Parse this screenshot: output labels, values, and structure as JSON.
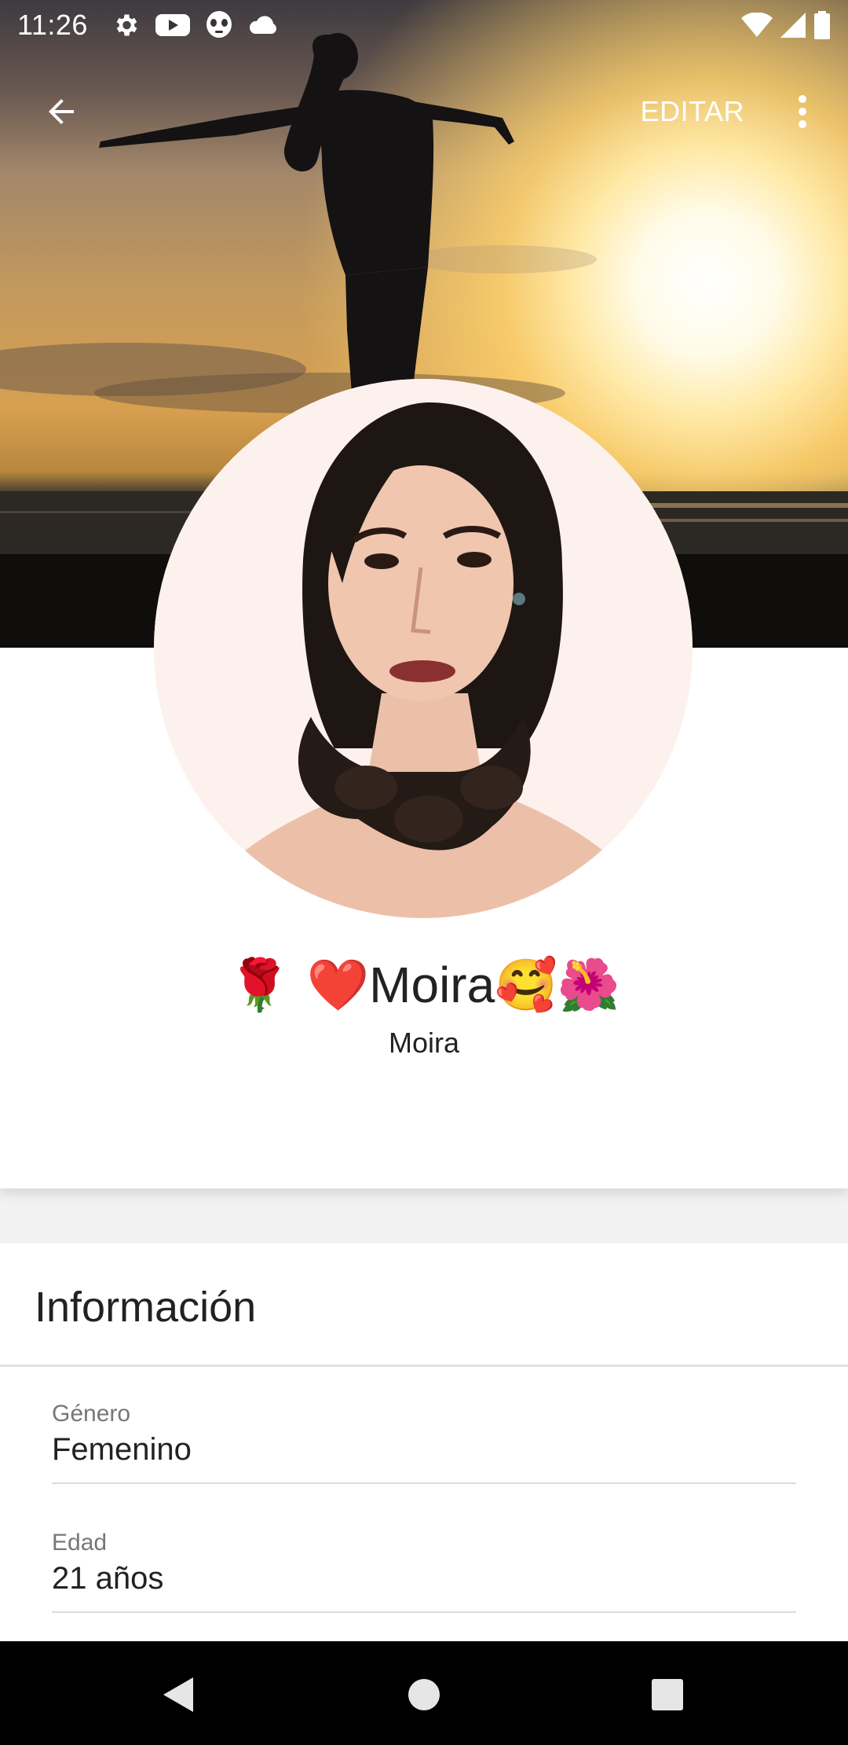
{
  "status_bar": {
    "time": "11:26",
    "left_icons": [
      "settings-icon",
      "youtube-icon",
      "alien-face-icon",
      "cloud-icon"
    ],
    "right_icons": [
      "wifi-icon",
      "signal-icon",
      "battery-icon"
    ]
  },
  "toolbar": {
    "back_icon": "arrow-left-icon",
    "edit_label": "EDITAR",
    "more_icon": "more-vertical-icon"
  },
  "profile": {
    "display_name": {
      "prefix_emoji": "🌹 ❤️",
      "name": "Moira",
      "suffix_emoji": "🥰🌺"
    },
    "username": "Moira"
  },
  "info": {
    "title": "Información",
    "fields": [
      {
        "label": "Género",
        "value": "Femenino"
      },
      {
        "label": "Edad",
        "value": "21 años"
      }
    ]
  },
  "colors": {
    "card_background": "#ffffff",
    "page_background": "#f2f2f2",
    "text_primary": "#222222",
    "text_secondary": "#777777",
    "nav_bar": "#000000"
  },
  "nav_bar": {
    "icons": [
      "back-triangle-icon",
      "home-circle-icon",
      "recents-square-icon"
    ]
  }
}
